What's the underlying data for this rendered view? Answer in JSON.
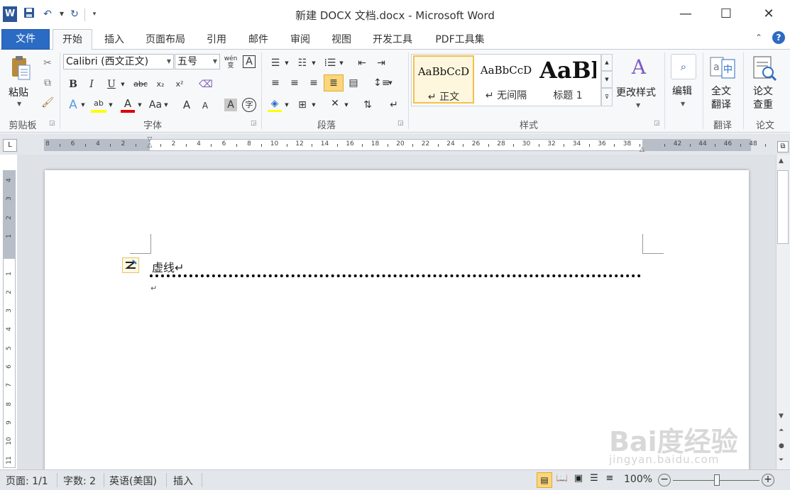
{
  "window": {
    "title": "新建 DOCX 文档.docx - Microsoft Word",
    "controls": {
      "minimize": "—",
      "maximize": "☐",
      "close": "✕"
    }
  },
  "quick_access": {
    "app_icon": "W"
  },
  "tabs": [
    {
      "label": "文件"
    },
    {
      "label": "开始"
    },
    {
      "label": "插入"
    },
    {
      "label": "页面布局"
    },
    {
      "label": "引用"
    },
    {
      "label": "邮件"
    },
    {
      "label": "审阅"
    },
    {
      "label": "视图"
    },
    {
      "label": "开发工具"
    },
    {
      "label": "PDF工具集"
    }
  ],
  "ribbon": {
    "clipboard": {
      "paste_label": "粘贴",
      "group_label": "剪贴板"
    },
    "font": {
      "font_name": "Calibri (西文正文)",
      "font_size": "五号",
      "phonetic_glyph": "wén",
      "char_border_glyph": "A",
      "bold": "B",
      "italic": "I",
      "underline": "U",
      "strike": "abc",
      "subscript": "x₂",
      "superscript": "x²",
      "text_effect": "A",
      "highlight": "ab",
      "font_color": "A",
      "change_case": "Aa",
      "grow": "A",
      "shrink": "A",
      "shading": "A",
      "enclose": "字",
      "group_label": "字体"
    },
    "paragraph": {
      "group_label": "段落"
    },
    "styles": {
      "items": [
        {
          "sample": "AaBbCcD",
          "name": "↵ 正文"
        },
        {
          "sample": "AaBbCcD",
          "name": "↵ 无间隔"
        },
        {
          "sample": "AaBl",
          "name": "标题 1"
        }
      ],
      "change_styles_label": "更改样式",
      "group_label": "样式"
    },
    "editing": {
      "label": "编辑"
    },
    "translate": {
      "label_line1": "全文",
      "label_line2": "翻译",
      "group_label": "翻译"
    },
    "paper": {
      "label_line1": "论文",
      "label_line2": "查重",
      "group_label": "论文"
    }
  },
  "ruler": {
    "horizontal_ticks": [
      "8",
      "6",
      "4",
      "2",
      "",
      "2",
      "4",
      "6",
      "8",
      "10",
      "12",
      "14",
      "16",
      "18",
      "20",
      "22",
      "24",
      "26",
      "28",
      "30",
      "32",
      "34",
      "36",
      "38",
      "",
      "42",
      "44",
      "46",
      "48"
    ],
    "vertical_ticks": [
      "4",
      "3",
      "2",
      "1",
      "",
      "1",
      "2",
      "3",
      "4",
      "5",
      "6",
      "7",
      "8",
      "9",
      "10",
      "11"
    ]
  },
  "document": {
    "line1": "虚线↵",
    "line2": "↵"
  },
  "status": {
    "page": "页面: 1/1",
    "words": "字数: 2",
    "language": "英语(美国)",
    "mode": "插入",
    "zoom": "100%",
    "zoom_level": 1.0
  },
  "watermark": {
    "brand": "Bai度经验",
    "url": "jingyan.baidu.com"
  },
  "colors": {
    "accent": "#2b6bc4",
    "highlight_yellow": "#ffff00",
    "font_red": "#e00000"
  }
}
